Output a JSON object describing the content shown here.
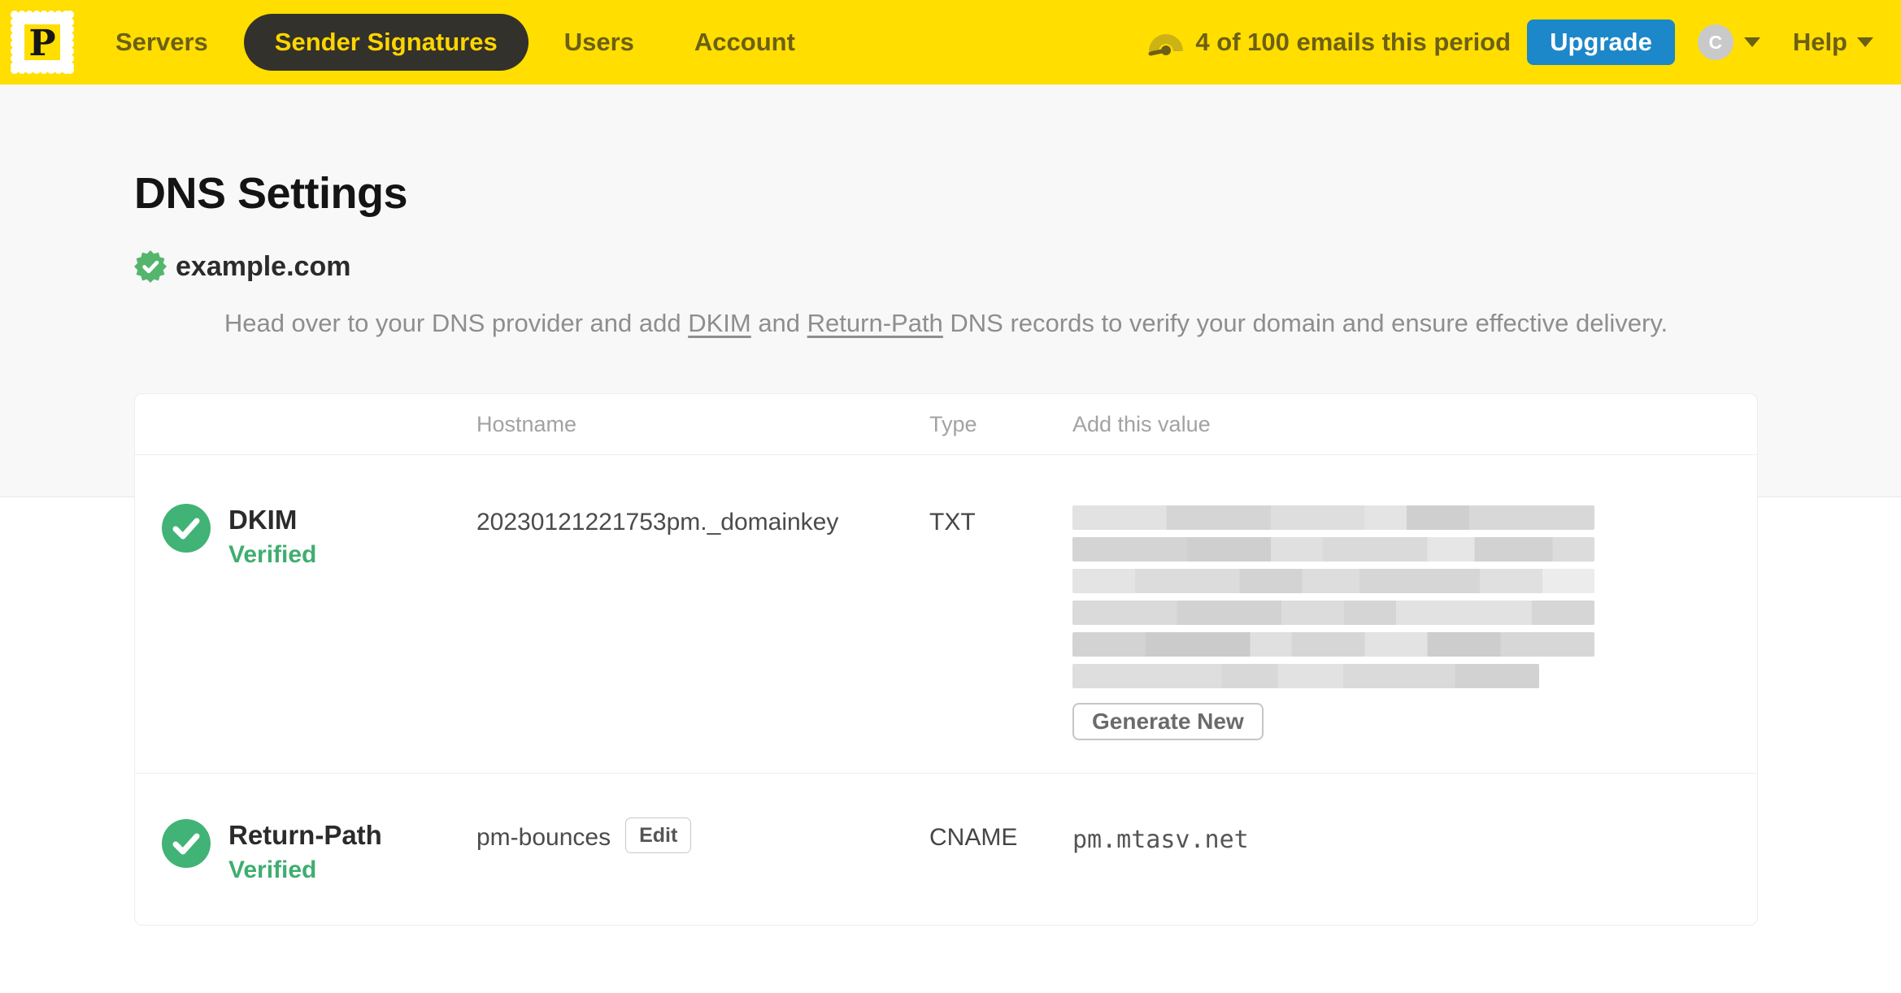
{
  "nav": {
    "logo_letter": "P",
    "items": [
      {
        "label": "Servers",
        "active": false
      },
      {
        "label": "Sender Signatures",
        "active": true
      },
      {
        "label": "Users",
        "active": false
      },
      {
        "label": "Account",
        "active": false
      }
    ],
    "usage_text": "4 of 100 emails this period",
    "upgrade_label": "Upgrade",
    "avatar_initial": "C",
    "help_label": "Help"
  },
  "page": {
    "title": "DNS Settings",
    "domain": "example.com",
    "intro_before": "Head over to your DNS provider and add ",
    "intro_link_dkim": "DKIM",
    "intro_and": " and ",
    "intro_link_returnpath": "Return-Path",
    "intro_after": " DNS records to verify your domain and ensure effective delivery."
  },
  "table": {
    "headers": {
      "hostname": "Hostname",
      "type": "Type",
      "value": "Add this value"
    },
    "rows": [
      {
        "name": "DKIM",
        "status": "Verified",
        "hostname": "20230121221753pm._domainkey",
        "type": "TXT",
        "value_redacted": true,
        "action_label": "Generate New"
      },
      {
        "name": "Return-Path",
        "status": "Verified",
        "hostname": "pm-bounces",
        "edit_label": "Edit",
        "type": "CNAME",
        "value": "pm.mtasv.net"
      }
    ]
  },
  "colors": {
    "brand_yellow": "#FFDE00",
    "nav_text_olive": "#6C5F16",
    "pill_bg": "#33312B",
    "upgrade_blue": "#1C87C9",
    "verified_green": "#3FAE70",
    "check_circle_green": "#41B376",
    "seal_green": "#55B56D"
  }
}
